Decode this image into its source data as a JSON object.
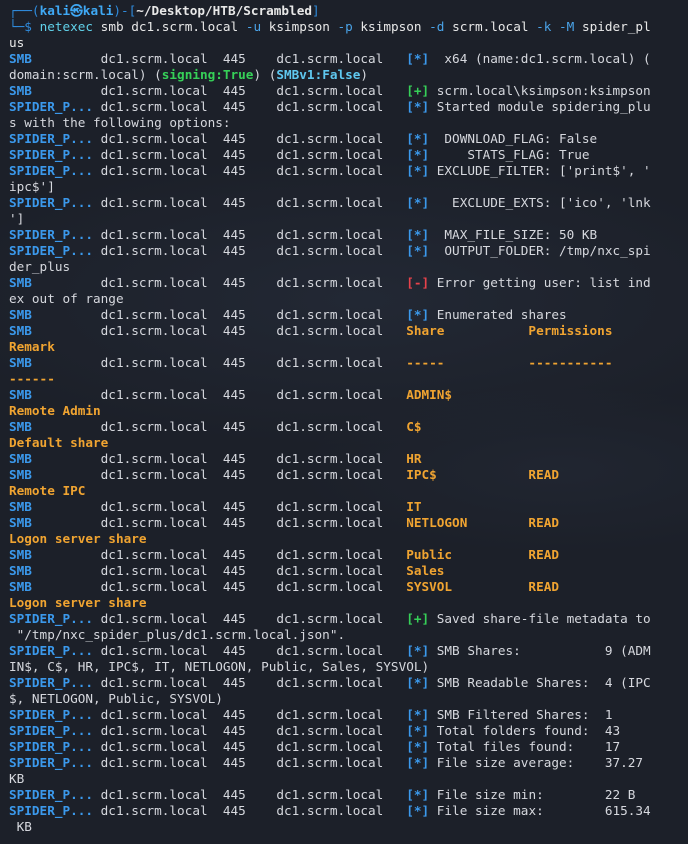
{
  "prompt": {
    "frame_top": "┌──(",
    "user_host": "kali㉿kali",
    "mid": ")-[",
    "path": "~/Desktop/HTB/Scrambled",
    "close": "]",
    "frame_bottom": "└─$ "
  },
  "command": {
    "program": "netexec",
    "args_line1_a": " smb dc1.scrm.local ",
    "flag_u": "-u",
    "args_line1_b": " ksimpson ",
    "flag_p": "-p",
    "args_line1_c": " ksimpson ",
    "flag_d": "-d",
    "args_line1_d": " scrm.local ",
    "flag_k": "-k",
    "args_line1_e": " ",
    "flag_M": "-M",
    "args_line1_f": " spider_pl",
    "args_line2": "us"
  },
  "colors": {
    "background": "#1c2029",
    "protocol_blue": "#3b99ec",
    "success_green": "#36d058",
    "error_red": "#e8424b",
    "share_yellow": "#f0a431",
    "smb_cyan": "#5fc8f0"
  },
  "lines": [
    {
      "segs": [
        {
          "c": "blue",
          "t": "SMB"
        },
        {
          "c": "txt",
          "t": "         dc1.scrm.local  445    dc1.scrm.local   "
        },
        {
          "c": "blue",
          "t": "[*]"
        },
        {
          "c": "txt",
          "t": "  x64 (name:dc1.scrm.local) ("
        }
      ]
    },
    {
      "segs": [
        {
          "c": "txt",
          "t": "domain:scrm.local) ("
        },
        {
          "c": "green",
          "t": "signing:True"
        },
        {
          "c": "txt",
          "t": ") ("
        },
        {
          "c": "cyan",
          "t": "SMBv1:False"
        },
        {
          "c": "txt",
          "t": ")"
        }
      ]
    },
    {
      "segs": [
        {
          "c": "blue",
          "t": "SMB"
        },
        {
          "c": "txt",
          "t": "         dc1.scrm.local  445    dc1.scrm.local   "
        },
        {
          "c": "green",
          "t": "[+]"
        },
        {
          "c": "txt",
          "t": " scrm.local\\ksimpson:ksimpson"
        }
      ]
    },
    {
      "segs": [
        {
          "c": "blue",
          "t": "SPIDER_P..."
        },
        {
          "c": "txt",
          "t": " dc1.scrm.local  445    dc1.scrm.local   "
        },
        {
          "c": "blue",
          "t": "[*]"
        },
        {
          "c": "txt",
          "t": " Started module spidering_plu"
        }
      ]
    },
    {
      "segs": [
        {
          "c": "txt",
          "t": "s with the following options:"
        }
      ]
    },
    {
      "segs": [
        {
          "c": "blue",
          "t": "SPIDER_P..."
        },
        {
          "c": "txt",
          "t": " dc1.scrm.local  445    dc1.scrm.local   "
        },
        {
          "c": "blue",
          "t": "[*]"
        },
        {
          "c": "txt",
          "t": "  DOWNLOAD_FLAG: False"
        }
      ]
    },
    {
      "segs": [
        {
          "c": "blue",
          "t": "SPIDER_P..."
        },
        {
          "c": "txt",
          "t": " dc1.scrm.local  445    dc1.scrm.local   "
        },
        {
          "c": "blue",
          "t": "[*]"
        },
        {
          "c": "txt",
          "t": "     STATS_FLAG: True"
        }
      ]
    },
    {
      "segs": [
        {
          "c": "blue",
          "t": "SPIDER_P..."
        },
        {
          "c": "txt",
          "t": " dc1.scrm.local  445    dc1.scrm.local   "
        },
        {
          "c": "blue",
          "t": "[*]"
        },
        {
          "c": "txt",
          "t": " EXCLUDE_FILTER: ['print$', '"
        }
      ]
    },
    {
      "segs": [
        {
          "c": "txt",
          "t": "ipc$']"
        }
      ]
    },
    {
      "segs": [
        {
          "c": "blue",
          "t": "SPIDER_P..."
        },
        {
          "c": "txt",
          "t": " dc1.scrm.local  445    dc1.scrm.local   "
        },
        {
          "c": "blue",
          "t": "[*]"
        },
        {
          "c": "txt",
          "t": "   EXCLUDE_EXTS: ['ico', 'lnk"
        }
      ]
    },
    {
      "segs": [
        {
          "c": "txt",
          "t": "']"
        }
      ]
    },
    {
      "segs": [
        {
          "c": "blue",
          "t": "SPIDER_P..."
        },
        {
          "c": "txt",
          "t": " dc1.scrm.local  445    dc1.scrm.local   "
        },
        {
          "c": "blue",
          "t": "[*]"
        },
        {
          "c": "txt",
          "t": "  MAX_FILE_SIZE: 50 KB"
        }
      ]
    },
    {
      "segs": [
        {
          "c": "blue",
          "t": "SPIDER_P..."
        },
        {
          "c": "txt",
          "t": " dc1.scrm.local  445    dc1.scrm.local   "
        },
        {
          "c": "blue",
          "t": "[*]"
        },
        {
          "c": "txt",
          "t": "  OUTPUT_FOLDER: /tmp/nxc_spi"
        }
      ]
    },
    {
      "segs": [
        {
          "c": "txt",
          "t": "der_plus"
        }
      ]
    },
    {
      "segs": [
        {
          "c": "blue",
          "t": "SMB"
        },
        {
          "c": "txt",
          "t": "         dc1.scrm.local  445    dc1.scrm.local   "
        },
        {
          "c": "red",
          "t": "[-]"
        },
        {
          "c": "txt",
          "t": " Error getting user: list ind"
        }
      ]
    },
    {
      "segs": [
        {
          "c": "txt",
          "t": "ex out of range"
        }
      ]
    },
    {
      "segs": [
        {
          "c": "blue",
          "t": "SMB"
        },
        {
          "c": "txt",
          "t": "         dc1.scrm.local  445    dc1.scrm.local   "
        },
        {
          "c": "blue",
          "t": "[*]"
        },
        {
          "c": "txt",
          "t": " Enumerated shares"
        }
      ]
    },
    {
      "segs": [
        {
          "c": "blue",
          "t": "SMB"
        },
        {
          "c": "txt",
          "t": "         dc1.scrm.local  445    dc1.scrm.local   "
        },
        {
          "c": "yellow",
          "t": "Share           Permissions"
        }
      ]
    },
    {
      "segs": [
        {
          "c": "yellow",
          "t": "Remark"
        }
      ]
    },
    {
      "segs": [
        {
          "c": "blue",
          "t": "SMB"
        },
        {
          "c": "txt",
          "t": "         dc1.scrm.local  445    dc1.scrm.local   "
        },
        {
          "c": "yellow",
          "t": "-----           -----------"
        }
      ]
    },
    {
      "segs": [
        {
          "c": "yellow",
          "t": "------"
        }
      ]
    },
    {
      "segs": [
        {
          "c": "blue",
          "t": "SMB"
        },
        {
          "c": "txt",
          "t": "         dc1.scrm.local  445    dc1.scrm.local   "
        },
        {
          "c": "yellow",
          "t": "ADMIN$"
        }
      ]
    },
    {
      "segs": [
        {
          "c": "yellow",
          "t": "Remote Admin"
        }
      ]
    },
    {
      "segs": [
        {
          "c": "blue",
          "t": "SMB"
        },
        {
          "c": "txt",
          "t": "         dc1.scrm.local  445    dc1.scrm.local   "
        },
        {
          "c": "yellow",
          "t": "C$"
        }
      ]
    },
    {
      "segs": [
        {
          "c": "yellow",
          "t": "Default share"
        }
      ]
    },
    {
      "segs": [
        {
          "c": "blue",
          "t": "SMB"
        },
        {
          "c": "txt",
          "t": "         dc1.scrm.local  445    dc1.scrm.local   "
        },
        {
          "c": "yellow",
          "t": "HR"
        }
      ]
    },
    {
      "segs": [
        {
          "c": "blue",
          "t": "SMB"
        },
        {
          "c": "txt",
          "t": "         dc1.scrm.local  445    dc1.scrm.local   "
        },
        {
          "c": "yellow",
          "t": "IPC$            READ"
        }
      ]
    },
    {
      "segs": [
        {
          "c": "yellow",
          "t": "Remote IPC"
        }
      ]
    },
    {
      "segs": [
        {
          "c": "blue",
          "t": "SMB"
        },
        {
          "c": "txt",
          "t": "         dc1.scrm.local  445    dc1.scrm.local   "
        },
        {
          "c": "yellow",
          "t": "IT"
        }
      ]
    },
    {
      "segs": [
        {
          "c": "blue",
          "t": "SMB"
        },
        {
          "c": "txt",
          "t": "         dc1.scrm.local  445    dc1.scrm.local   "
        },
        {
          "c": "yellow",
          "t": "NETLOGON        READ"
        }
      ]
    },
    {
      "segs": [
        {
          "c": "yellow",
          "t": "Logon server share"
        }
      ]
    },
    {
      "segs": [
        {
          "c": "blue",
          "t": "SMB"
        },
        {
          "c": "txt",
          "t": "         dc1.scrm.local  445    dc1.scrm.local   "
        },
        {
          "c": "yellow",
          "t": "Public          READ"
        }
      ]
    },
    {
      "segs": [
        {
          "c": "blue",
          "t": "SMB"
        },
        {
          "c": "txt",
          "t": "         dc1.scrm.local  445    dc1.scrm.local   "
        },
        {
          "c": "yellow",
          "t": "Sales"
        }
      ]
    },
    {
      "segs": [
        {
          "c": "blue",
          "t": "SMB"
        },
        {
          "c": "txt",
          "t": "         dc1.scrm.local  445    dc1.scrm.local   "
        },
        {
          "c": "yellow",
          "t": "SYSVOL          READ"
        }
      ]
    },
    {
      "segs": [
        {
          "c": "yellow",
          "t": "Logon server share"
        }
      ]
    },
    {
      "segs": [
        {
          "c": "blue",
          "t": "SPIDER_P..."
        },
        {
          "c": "txt",
          "t": " dc1.scrm.local  445    dc1.scrm.local   "
        },
        {
          "c": "green",
          "t": "[+]"
        },
        {
          "c": "txt",
          "t": " Saved share-file metadata to"
        }
      ]
    },
    {
      "segs": [
        {
          "c": "txt",
          "t": " \"/tmp/nxc_spider_plus/dc1.scrm.local.json\"."
        }
      ]
    },
    {
      "segs": [
        {
          "c": "blue",
          "t": "SPIDER_P..."
        },
        {
          "c": "txt",
          "t": " dc1.scrm.local  445    dc1.scrm.local   "
        },
        {
          "c": "blue",
          "t": "[*]"
        },
        {
          "c": "txt",
          "t": " SMB Shares:           9 (ADM"
        }
      ]
    },
    {
      "segs": [
        {
          "c": "txt",
          "t": "IN$, C$, HR, IPC$, IT, NETLOGON, Public, Sales, SYSVOL)"
        }
      ]
    },
    {
      "segs": [
        {
          "c": "blue",
          "t": "SPIDER_P..."
        },
        {
          "c": "txt",
          "t": " dc1.scrm.local  445    dc1.scrm.local   "
        },
        {
          "c": "blue",
          "t": "[*]"
        },
        {
          "c": "txt",
          "t": " SMB Readable Shares:  4 (IPC"
        }
      ]
    },
    {
      "segs": [
        {
          "c": "txt",
          "t": "$, NETLOGON, Public, SYSVOL)"
        }
      ]
    },
    {
      "segs": [
        {
          "c": "blue",
          "t": "SPIDER_P..."
        },
        {
          "c": "txt",
          "t": " dc1.scrm.local  445    dc1.scrm.local   "
        },
        {
          "c": "blue",
          "t": "[*]"
        },
        {
          "c": "txt",
          "t": " SMB Filtered Shares:  1"
        }
      ]
    },
    {
      "segs": [
        {
          "c": "blue",
          "t": "SPIDER_P..."
        },
        {
          "c": "txt",
          "t": " dc1.scrm.local  445    dc1.scrm.local   "
        },
        {
          "c": "blue",
          "t": "[*]"
        },
        {
          "c": "txt",
          "t": " Total folders found:  43"
        }
      ]
    },
    {
      "segs": [
        {
          "c": "blue",
          "t": "SPIDER_P..."
        },
        {
          "c": "txt",
          "t": " dc1.scrm.local  445    dc1.scrm.local   "
        },
        {
          "c": "blue",
          "t": "[*]"
        },
        {
          "c": "txt",
          "t": " Total files found:    17"
        }
      ]
    },
    {
      "segs": [
        {
          "c": "blue",
          "t": "SPIDER_P..."
        },
        {
          "c": "txt",
          "t": " dc1.scrm.local  445    dc1.scrm.local   "
        },
        {
          "c": "blue",
          "t": "[*]"
        },
        {
          "c": "txt",
          "t": " File size average:    37.27"
        }
      ]
    },
    {
      "segs": [
        {
          "c": "txt",
          "t": "KB"
        }
      ]
    },
    {
      "segs": [
        {
          "c": "blue",
          "t": "SPIDER_P..."
        },
        {
          "c": "txt",
          "t": " dc1.scrm.local  445    dc1.scrm.local   "
        },
        {
          "c": "blue",
          "t": "[*]"
        },
        {
          "c": "txt",
          "t": " File size min:        22 B"
        }
      ]
    },
    {
      "segs": [
        {
          "c": "blue",
          "t": "SPIDER_P..."
        },
        {
          "c": "txt",
          "t": " dc1.scrm.local  445    dc1.scrm.local   "
        },
        {
          "c": "blue",
          "t": "[*]"
        },
        {
          "c": "txt",
          "t": " File size max:        615.34"
        }
      ]
    },
    {
      "segs": [
        {
          "c": "txt",
          "t": " KB"
        }
      ]
    }
  ]
}
